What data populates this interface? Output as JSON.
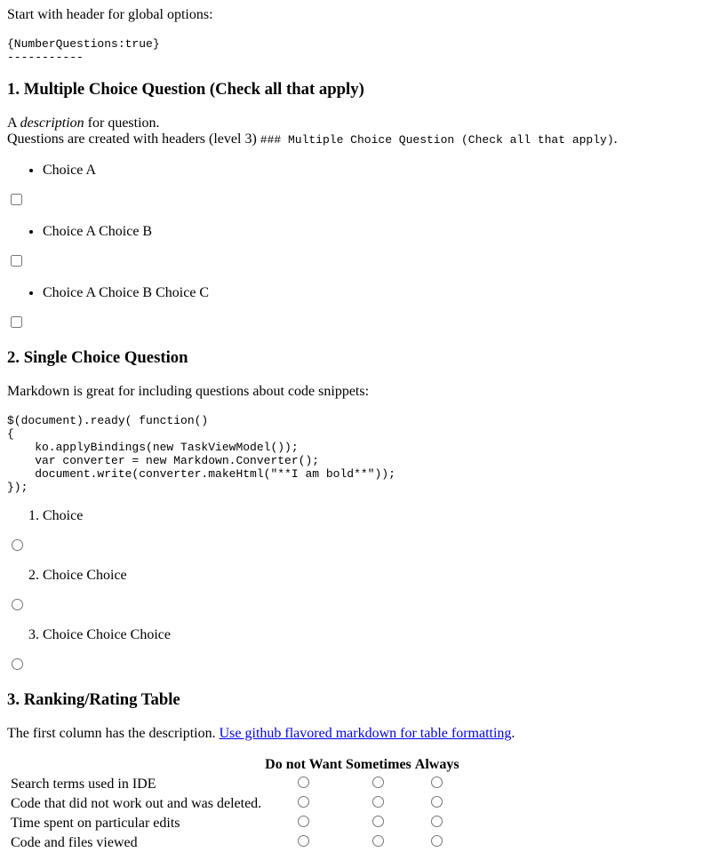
{
  "intro": {
    "text": "Start with header for global options:",
    "options_code": "{NumberQuestions:true}",
    "rule": "-----------"
  },
  "q1": {
    "title": "1. Multiple Choice Question (Check all that apply)",
    "desc_a": "A",
    "desc_em": "description",
    "desc_rest": "for question.",
    "line2_text": "Questions are created with headers (level 3)",
    "line2_code": "### Multiple Choice Question (Check all that apply)",
    "line2_end": ".",
    "choices": [
      "Choice A",
      "Choice A Choice B",
      "Choice A Choice B Choice C"
    ]
  },
  "q2": {
    "title": "2. Single Choice Question",
    "desc": "Markdown is great for including questions about code snippets:",
    "code": "$(document).ready( function()\n{\n    ko.applyBindings(new TaskViewModel());\n    var converter = new Markdown.Converter();\n    document.write(converter.makeHtml(\"**I am bold**\"));\n});",
    "choices": [
      "Choice",
      "Choice Choice",
      "Choice Choice Choice"
    ]
  },
  "q3": {
    "title": "3. Ranking/Rating Table",
    "desc": "The first column has the description.",
    "link": "Use github flavored markdown for table formatting",
    "desc_end": ".",
    "headers": [
      "Do not Want",
      "Sometimes",
      "Always"
    ],
    "rows": [
      "Search terms used in IDE",
      "Code that did not work out and was deleted.",
      "Time spent on particular edits",
      "Code and files viewed"
    ]
  }
}
